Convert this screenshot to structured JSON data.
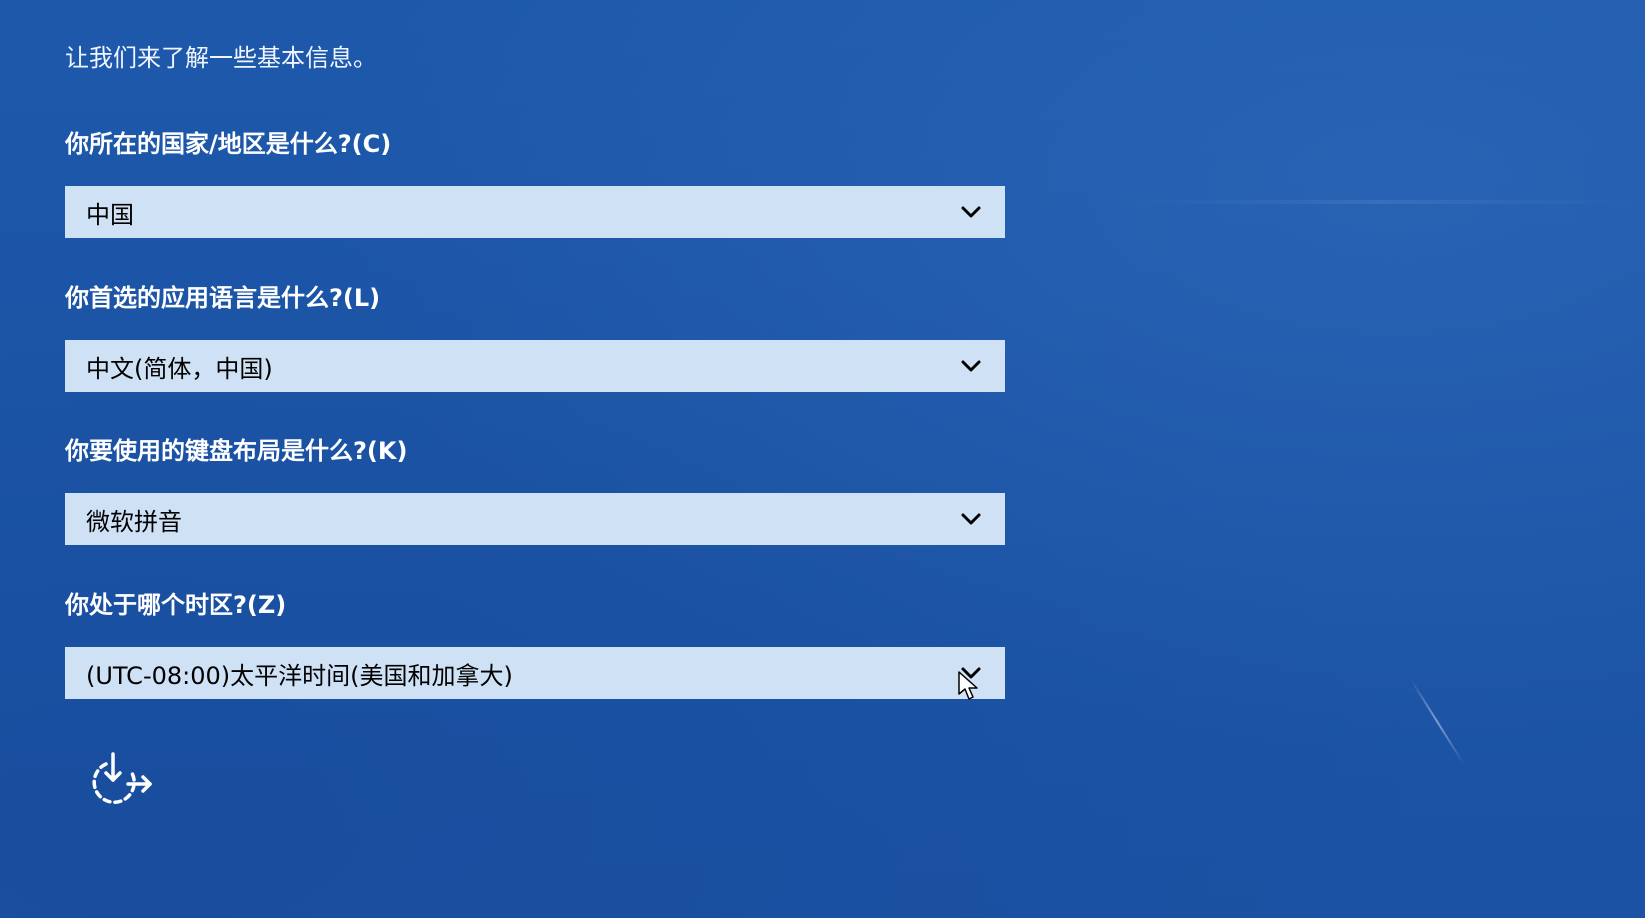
{
  "intro": "让我们来了解一些基本信息。",
  "fields": [
    {
      "question": "你所在的国家/地区是什么?(C)",
      "value": "中国"
    },
    {
      "question": "你首选的应用语言是什么?(L)",
      "value": "中文(简体，中国)"
    },
    {
      "question": "你要使用的键盘布局是什么?(K)",
      "value": "微软拼音"
    },
    {
      "question": "你处于哪个时区?(Z)",
      "value": "(UTC-08:00)太平洋时间(美国和加拿大)"
    }
  ],
  "icons": {
    "dropdown": "chevron-down-icon",
    "accessibility": "ease-of-access-icon",
    "pointer": "mouse-cursor-icon"
  },
  "colors": {
    "background": "#1e56a8",
    "select_bg": "#cfe1f5",
    "text": "#ffffff"
  }
}
